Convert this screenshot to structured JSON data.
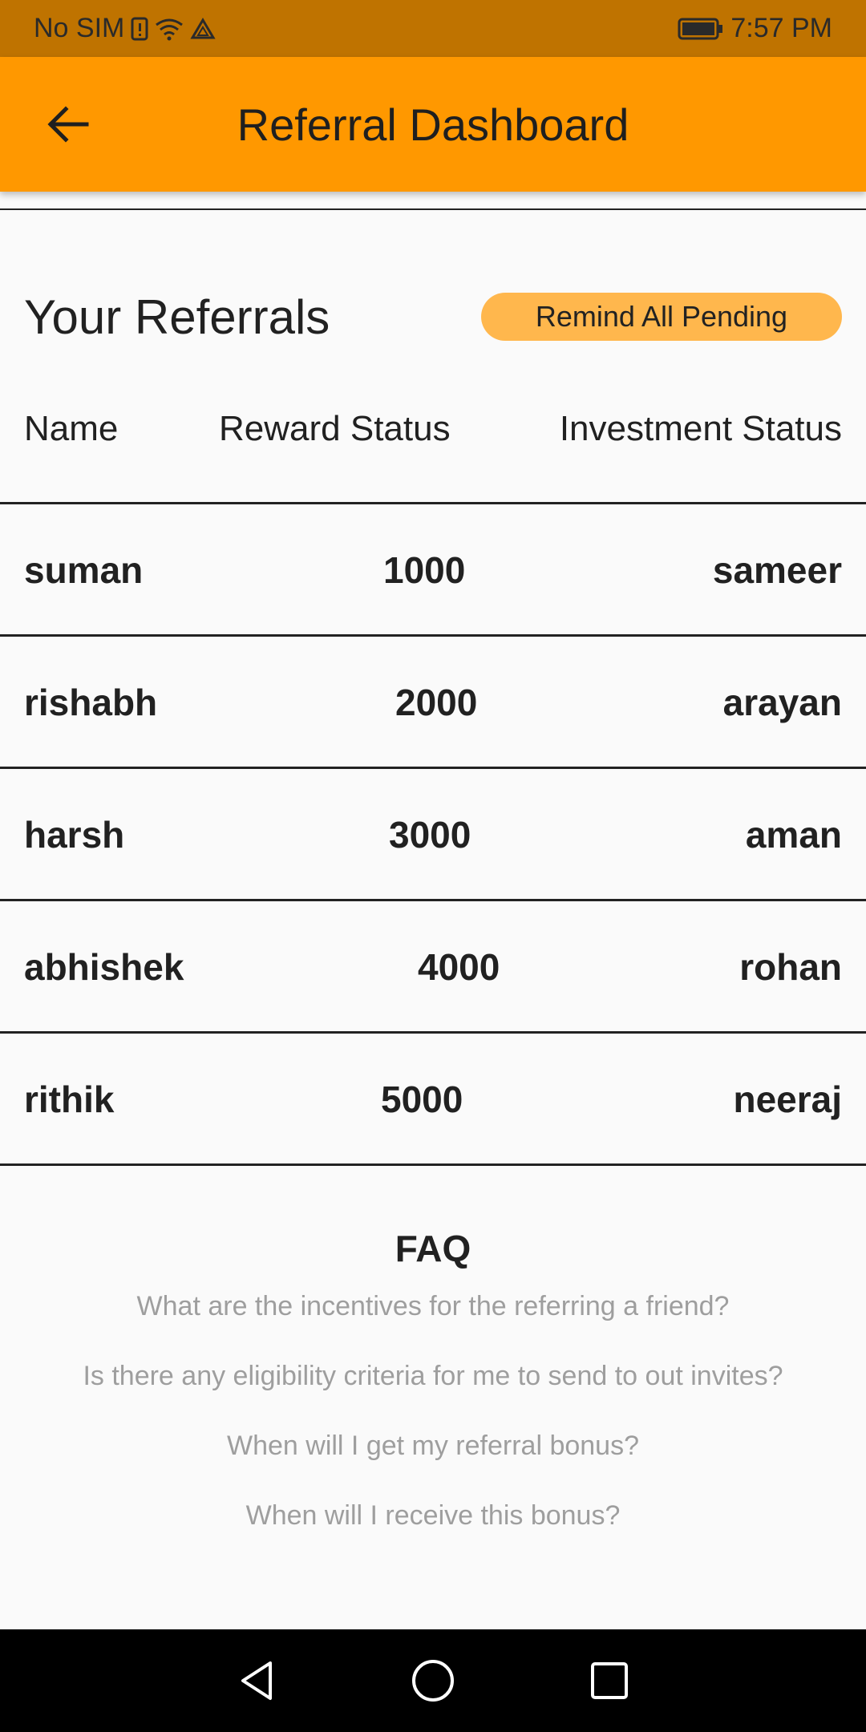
{
  "status_bar": {
    "carrier": "No SIM",
    "time": "7:57 PM"
  },
  "app_bar": {
    "title": "Referral Dashboard"
  },
  "referrals": {
    "title": "Your Referrals",
    "remind_button": "Remind All Pending",
    "columns": [
      "Name",
      "Reward Status",
      "Investment Status"
    ],
    "rows": [
      {
        "name": "suman",
        "reward": "1000",
        "investment": "sameer"
      },
      {
        "name": "rishabh",
        "reward": "2000",
        "investment": "arayan"
      },
      {
        "name": "harsh",
        "reward": "3000",
        "investment": "aman"
      },
      {
        "name": "abhishek",
        "reward": "4000",
        "investment": "rohan"
      },
      {
        "name": "rithik",
        "reward": "5000",
        "investment": "neeraj"
      }
    ]
  },
  "faq": {
    "title": "FAQ",
    "items": [
      "What are the incentives for the referring a friend?",
      "Is there any eligibility criteria for me to send to out invites?",
      "When will I get my referral bonus?",
      "When will I receive this bonus?"
    ]
  },
  "colors": {
    "status_bar": "#bf7300",
    "app_bar": "#ff9800",
    "remind_button": "#ffb74d"
  },
  "icons": {
    "back": "arrow-left-icon",
    "nav_back": "triangle-back-icon",
    "nav_home": "circle-home-icon",
    "nav_recents": "square-recents-icon"
  }
}
